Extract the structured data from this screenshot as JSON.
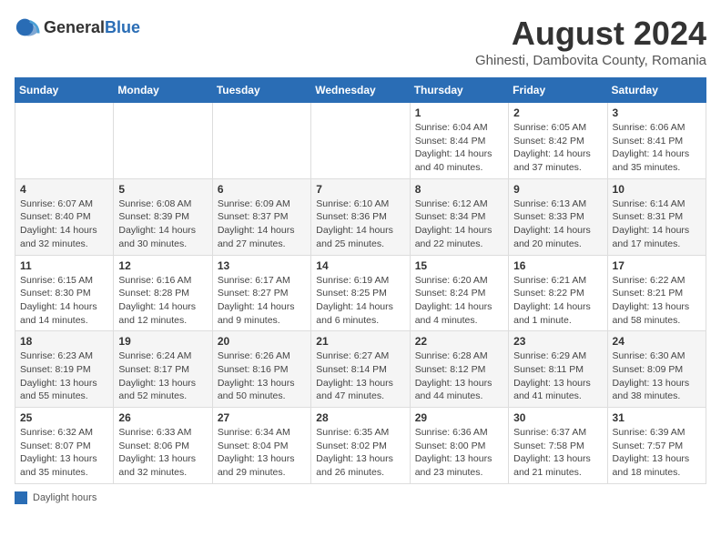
{
  "header": {
    "logo_general": "General",
    "logo_blue": "Blue",
    "month_title": "August 2024",
    "location": "Ghinesti, Dambovita County, Romania"
  },
  "days_of_week": [
    "Sunday",
    "Monday",
    "Tuesday",
    "Wednesday",
    "Thursday",
    "Friday",
    "Saturday"
  ],
  "weeks": [
    [
      {
        "day": "",
        "info": ""
      },
      {
        "day": "",
        "info": ""
      },
      {
        "day": "",
        "info": ""
      },
      {
        "day": "",
        "info": ""
      },
      {
        "day": "1",
        "info": "Sunrise: 6:04 AM\nSunset: 8:44 PM\nDaylight: 14 hours\nand 40 minutes."
      },
      {
        "day": "2",
        "info": "Sunrise: 6:05 AM\nSunset: 8:42 PM\nDaylight: 14 hours\nand 37 minutes."
      },
      {
        "day": "3",
        "info": "Sunrise: 6:06 AM\nSunset: 8:41 PM\nDaylight: 14 hours\nand 35 minutes."
      }
    ],
    [
      {
        "day": "4",
        "info": "Sunrise: 6:07 AM\nSunset: 8:40 PM\nDaylight: 14 hours\nand 32 minutes."
      },
      {
        "day": "5",
        "info": "Sunrise: 6:08 AM\nSunset: 8:39 PM\nDaylight: 14 hours\nand 30 minutes."
      },
      {
        "day": "6",
        "info": "Sunrise: 6:09 AM\nSunset: 8:37 PM\nDaylight: 14 hours\nand 27 minutes."
      },
      {
        "day": "7",
        "info": "Sunrise: 6:10 AM\nSunset: 8:36 PM\nDaylight: 14 hours\nand 25 minutes."
      },
      {
        "day": "8",
        "info": "Sunrise: 6:12 AM\nSunset: 8:34 PM\nDaylight: 14 hours\nand 22 minutes."
      },
      {
        "day": "9",
        "info": "Sunrise: 6:13 AM\nSunset: 8:33 PM\nDaylight: 14 hours\nand 20 minutes."
      },
      {
        "day": "10",
        "info": "Sunrise: 6:14 AM\nSunset: 8:31 PM\nDaylight: 14 hours\nand 17 minutes."
      }
    ],
    [
      {
        "day": "11",
        "info": "Sunrise: 6:15 AM\nSunset: 8:30 PM\nDaylight: 14 hours\nand 14 minutes."
      },
      {
        "day": "12",
        "info": "Sunrise: 6:16 AM\nSunset: 8:28 PM\nDaylight: 14 hours\nand 12 minutes."
      },
      {
        "day": "13",
        "info": "Sunrise: 6:17 AM\nSunset: 8:27 PM\nDaylight: 14 hours\nand 9 minutes."
      },
      {
        "day": "14",
        "info": "Sunrise: 6:19 AM\nSunset: 8:25 PM\nDaylight: 14 hours\nand 6 minutes."
      },
      {
        "day": "15",
        "info": "Sunrise: 6:20 AM\nSunset: 8:24 PM\nDaylight: 14 hours\nand 4 minutes."
      },
      {
        "day": "16",
        "info": "Sunrise: 6:21 AM\nSunset: 8:22 PM\nDaylight: 14 hours\nand 1 minute."
      },
      {
        "day": "17",
        "info": "Sunrise: 6:22 AM\nSunset: 8:21 PM\nDaylight: 13 hours\nand 58 minutes."
      }
    ],
    [
      {
        "day": "18",
        "info": "Sunrise: 6:23 AM\nSunset: 8:19 PM\nDaylight: 13 hours\nand 55 minutes."
      },
      {
        "day": "19",
        "info": "Sunrise: 6:24 AM\nSunset: 8:17 PM\nDaylight: 13 hours\nand 52 minutes."
      },
      {
        "day": "20",
        "info": "Sunrise: 6:26 AM\nSunset: 8:16 PM\nDaylight: 13 hours\nand 50 minutes."
      },
      {
        "day": "21",
        "info": "Sunrise: 6:27 AM\nSunset: 8:14 PM\nDaylight: 13 hours\nand 47 minutes."
      },
      {
        "day": "22",
        "info": "Sunrise: 6:28 AM\nSunset: 8:12 PM\nDaylight: 13 hours\nand 44 minutes."
      },
      {
        "day": "23",
        "info": "Sunrise: 6:29 AM\nSunset: 8:11 PM\nDaylight: 13 hours\nand 41 minutes."
      },
      {
        "day": "24",
        "info": "Sunrise: 6:30 AM\nSunset: 8:09 PM\nDaylight: 13 hours\nand 38 minutes."
      }
    ],
    [
      {
        "day": "25",
        "info": "Sunrise: 6:32 AM\nSunset: 8:07 PM\nDaylight: 13 hours\nand 35 minutes."
      },
      {
        "day": "26",
        "info": "Sunrise: 6:33 AM\nSunset: 8:06 PM\nDaylight: 13 hours\nand 32 minutes."
      },
      {
        "day": "27",
        "info": "Sunrise: 6:34 AM\nSunset: 8:04 PM\nDaylight: 13 hours\nand 29 minutes."
      },
      {
        "day": "28",
        "info": "Sunrise: 6:35 AM\nSunset: 8:02 PM\nDaylight: 13 hours\nand 26 minutes."
      },
      {
        "day": "29",
        "info": "Sunrise: 6:36 AM\nSunset: 8:00 PM\nDaylight: 13 hours\nand 23 minutes."
      },
      {
        "day": "30",
        "info": "Sunrise: 6:37 AM\nSunset: 7:58 PM\nDaylight: 13 hours\nand 21 minutes."
      },
      {
        "day": "31",
        "info": "Sunrise: 6:39 AM\nSunset: 7:57 PM\nDaylight: 13 hours\nand 18 minutes."
      }
    ]
  ],
  "footer": {
    "legend_label": "Daylight hours"
  }
}
